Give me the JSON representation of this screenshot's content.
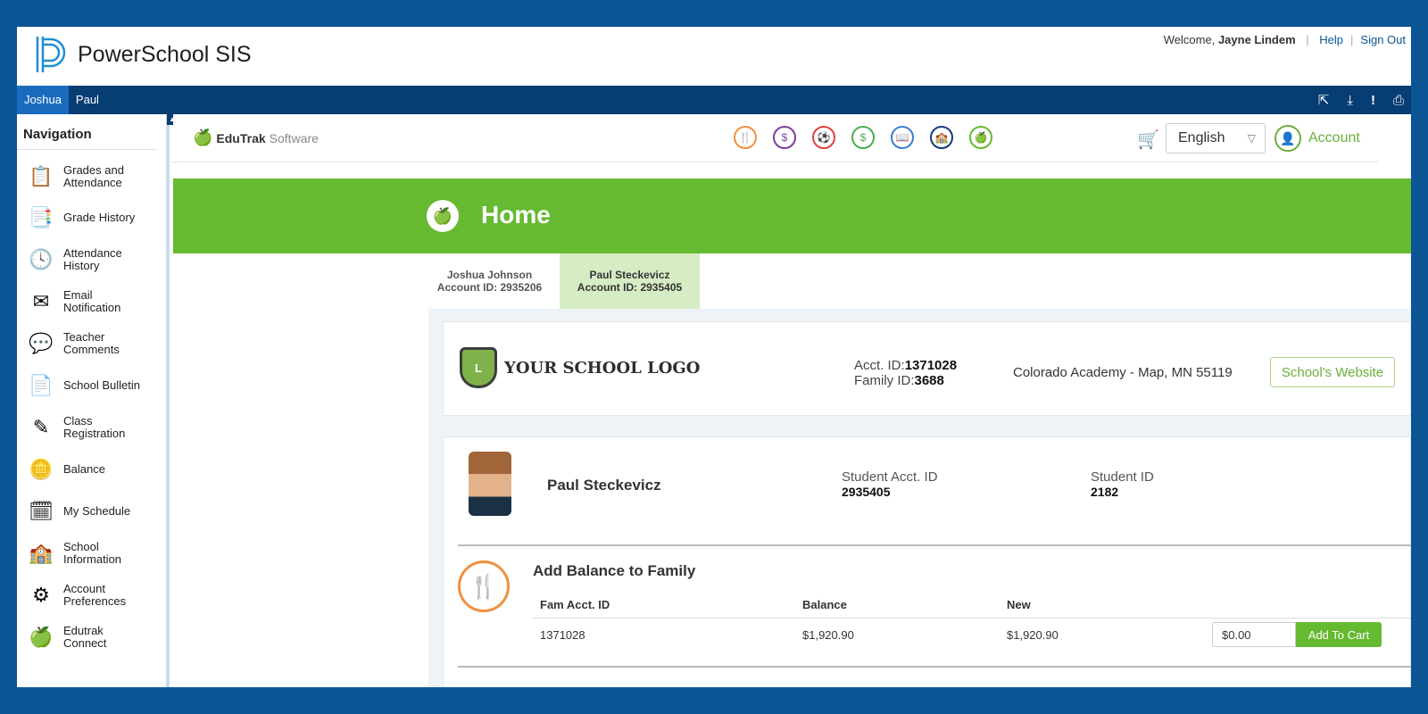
{
  "header": {
    "app_title": "PowerSchool SIS",
    "welcome_prefix": "Welcome,",
    "user_name": "Jayne Lindem",
    "help_label": "Help",
    "signout_label": "Sign Out"
  },
  "student_bar": {
    "students": [
      "Joshua",
      "Paul"
    ],
    "active": "Joshua",
    "icons": [
      "external-link-icon",
      "download-icon",
      "alert-icon",
      "print-icon"
    ]
  },
  "sidebar": {
    "heading": "Navigation",
    "items": [
      {
        "label": "Grades and Attendance",
        "icon": "grades-icon"
      },
      {
        "label": "Grade History",
        "icon": "grade-history-icon"
      },
      {
        "label": "Attendance History",
        "icon": "attendance-history-icon"
      },
      {
        "label": "Email Notification",
        "icon": "email-icon"
      },
      {
        "label": "Teacher Comments",
        "icon": "comments-icon"
      },
      {
        "label": "School Bulletin",
        "icon": "bulletin-icon"
      },
      {
        "label": "Class Registration",
        "icon": "registration-icon"
      },
      {
        "label": "Balance",
        "icon": "balance-icon"
      },
      {
        "label": "My Schedule",
        "icon": "schedule-icon"
      },
      {
        "label": "School Information",
        "icon": "school-icon"
      },
      {
        "label": "Account Preferences",
        "icon": "preferences-icon"
      },
      {
        "label": "Edutrak Connect",
        "icon": "edutrak-icon"
      }
    ]
  },
  "edutrak": {
    "logo_edu": "EduTrak",
    "logo_software": "Software",
    "service_icons": [
      "meals-icon",
      "fees-icon",
      "activities-icon",
      "payments-icon",
      "books-icon",
      "school-store-icon",
      "edutrak-connect-icon"
    ],
    "language": "English",
    "account_label": "Account"
  },
  "banner": {
    "title": "Home"
  },
  "account_tabs": [
    {
      "name": "Joshua Johnson",
      "account": "Account ID: 2935206"
    },
    {
      "name": "Paul Steckevicz",
      "account": "Account ID: 2935405"
    }
  ],
  "school_card": {
    "logo_text": "YOUR SCHOOL LOGO",
    "acct_id_label": "Acct. ID:",
    "acct_id": "1371028",
    "family_id_label": "Family ID:",
    "family_id": "3688",
    "address": "Colorado Academy - Map, MN 55119",
    "website_button": "School's Website"
  },
  "student_card": {
    "name": "Paul Steckevicz",
    "student_acct_label": "Student Acct. ID",
    "student_acct": "2935405",
    "student_id_label": "Student ID",
    "student_id": "2182",
    "section_title": "Add Balance to Family",
    "columns": [
      "Fam Acct. ID",
      "Balance",
      "New"
    ],
    "row": {
      "fam_acct": "1371028",
      "balance": "$1,920.90",
      "new": "$1,920.90"
    },
    "amount_value": "$0.00",
    "add_button": "Add To Cart"
  },
  "colors": {
    "brand_blue": "#0b5594",
    "edutrak_green": "#66ba32",
    "meal_orange": "#f2903f"
  }
}
